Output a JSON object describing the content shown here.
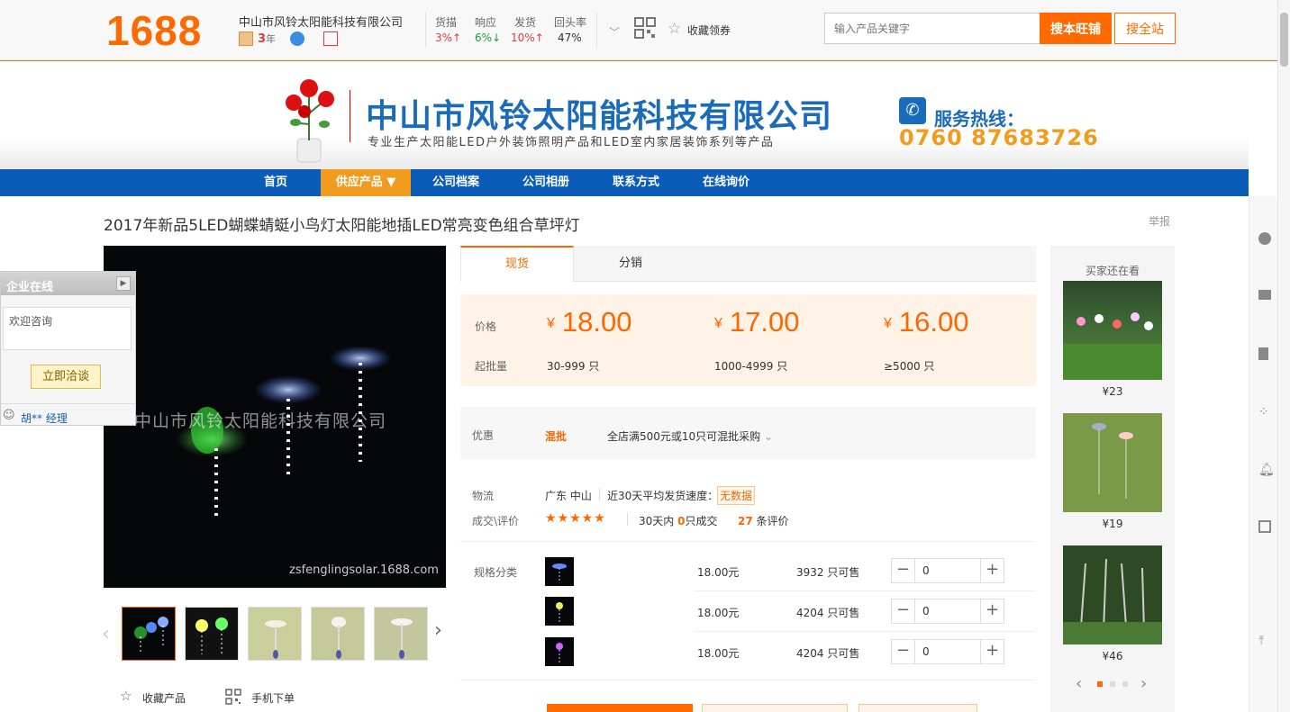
{
  "header": {
    "logo": "1688",
    "company": "中山市风铃太阳能科技有限公司",
    "years": "3",
    "years_unit": "年",
    "metrics": [
      {
        "label": "货描",
        "value": "3%↑",
        "color": "#e4393c"
      },
      {
        "label": "响应",
        "value": "6%↓",
        "color": "#1e9c3c"
      },
      {
        "label": "发货",
        "value": "10%↑",
        "color": "#e4393c"
      },
      {
        "label": "回头率",
        "value": "47%",
        "color": "#333333"
      }
    ],
    "favorite_coupon": "收藏领券",
    "search_placeholder": "输入产品关键字",
    "search_shop": "搜本旺铺",
    "search_all": "搜全站"
  },
  "banner": {
    "company": "中山市风铃太阳能科技有限公司",
    "slogan": "专业生产太阳能LED户外装饰照明产品和LED室内家居装饰系列等产品",
    "hotline_label": "服务热线：",
    "hotline_number": "0760 87683726"
  },
  "nav": [
    "首页",
    "供应产品 ▼",
    "公司档案",
    "公司相册",
    "联系方式",
    "在线询价"
  ],
  "product": {
    "title": "2017年新品5LED蝴蝶蜻蜓小鸟灯太阳能地插LED常亮变色组合草坪灯",
    "report": "举报",
    "watermark": "中山市风铃太阳能科技有限公司",
    "watermark_url": "zsfenglingsolar.1688.com",
    "collect": "收藏产品",
    "mobile_order": "手机下单"
  },
  "tabs": [
    "现货",
    "分销"
  ],
  "pricing": {
    "price_label": "价格",
    "qty_label": "起批量",
    "tiers": [
      {
        "price": "18.00",
        "qty": "30-999 只"
      },
      {
        "price": "17.00",
        "qty": "1000-4999 只"
      },
      {
        "price": "16.00",
        "qty": "≥5000 只"
      }
    ],
    "currency": "¥"
  },
  "promo": {
    "label": "优惠",
    "tag": "混批",
    "text": "全店满500元或10只可混批采购"
  },
  "logistics": {
    "label": "物流",
    "origin": "广东 中山",
    "speed": "近30天平均发货速度：",
    "speed_value": "无数据",
    "deals_label": "成交\\评价",
    "stars": "★★★★★",
    "deals_prefix": "30天内",
    "deals_count": "0",
    "deals_suffix": "只成交",
    "reviews_count": "27",
    "reviews_suffix": "条评价"
  },
  "sku": {
    "label": "规格分类",
    "rows": [
      {
        "price": "18.00元",
        "stock": "3932 只可售",
        "qty": "0"
      },
      {
        "price": "18.00元",
        "stock": "4204 只可售",
        "qty": "0"
      },
      {
        "price": "18.00元",
        "stock": "4204 只可售",
        "qty": "0"
      }
    ]
  },
  "online": {
    "title": "企业在线",
    "placeholder": "欢迎咨询",
    "chat_button": "立即洽谈",
    "contact": "胡** 经理"
  },
  "recommend": {
    "title": "买家还在看",
    "items": [
      {
        "price": "¥23"
      },
      {
        "price": "¥19"
      },
      {
        "price": "¥46"
      }
    ]
  }
}
